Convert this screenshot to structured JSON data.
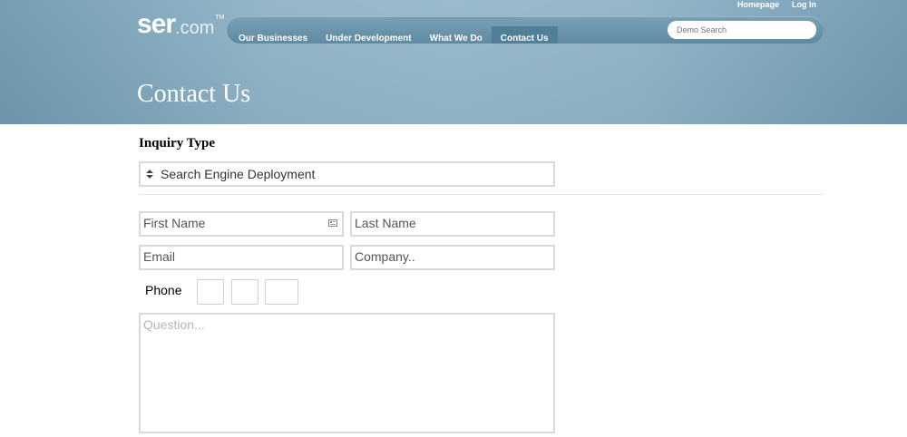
{
  "top_links": {
    "homepage": "Homepage",
    "login": "Log In"
  },
  "logo": {
    "ser": "ser",
    "dotcom": ".com",
    "tm": "TM"
  },
  "nav": {
    "items": [
      "Our Businesses",
      "Under Development",
      "What We Do",
      "Contact Us"
    ],
    "active": "Contact Us"
  },
  "search": {
    "placeholder": "Demo Search"
  },
  "page_title": "Contact Us",
  "form": {
    "inquiry_label": "Inquiry Type",
    "inquiry_value": "Search Engine Deployment",
    "first_name_placeholder": "First Name",
    "last_name_placeholder": "Last Name",
    "email_placeholder": "Email",
    "company_placeholder": "Company..",
    "phone_label": "Phone",
    "question_placeholder": "Question..."
  },
  "colors": {
    "header": "#8fb3c6",
    "navbar": "#6a93ab",
    "nav_active": "#527f98"
  },
  "icons": {
    "select": "up-down-arrows-icon",
    "autofill": "contact-card-icon"
  }
}
